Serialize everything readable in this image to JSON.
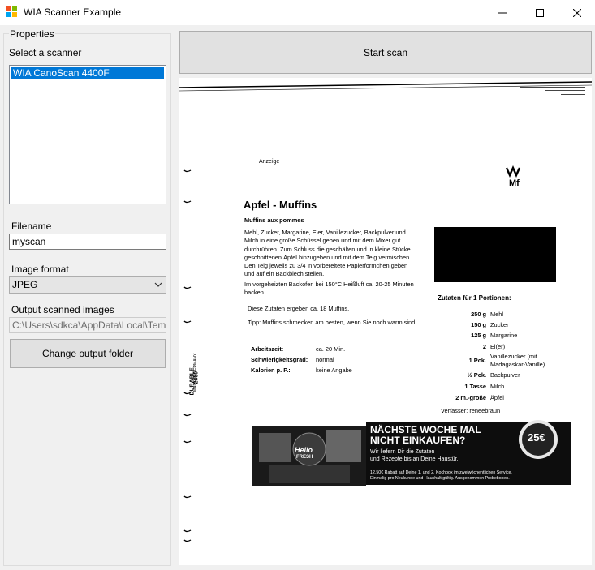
{
  "window": {
    "title": "WIA Scanner Example",
    "controls": {
      "minimize": "minimize",
      "maximize": "maximize",
      "close": "close"
    }
  },
  "left_panel": {
    "group_title": "Properties",
    "scanner_label": "Select a scanner",
    "scanners": [
      "WIA CanoScan 4400F"
    ],
    "selected_scanner": "WIA CanoScan 4400F",
    "filename_label": "Filename",
    "filename_value": "myscan",
    "format_label": "Image format",
    "format_selected": "JPEG",
    "output_label": "Output scanned images",
    "output_path": "C:\\Users\\sdkca\\AppData\\Local\\Temp\\",
    "change_folder_button": "Change output folder"
  },
  "toolbar": {
    "start_scan_button": "Start scan"
  },
  "scan_preview": {
    "ad_label": "Anzeige",
    "brand": "WMF",
    "recipe_title": "Apfel - Muffins",
    "recipe_subtitle": "Muffins aux pommes",
    "paragraph1": "Mehl, Zucker, Margarine, Eier, Vanillezucker, Backpulver und Milch in eine große Schüssel geben und mit dem Mixer gut durchrühren. Zum Schluss die geschälten und in kleine Stücke geschnittenen Äpfel hinzugeben und mit dem Teig vermischen. Den Teig jeweils zu 3/4 in vorbereitete Papierförmchen geben und auf ein Backblech stellen.",
    "paragraph2": "Im vorgeheizten Backofen bei 150°C Heißluft ca. 20-25 Minuten backen.",
    "paragraph3": "Diese Zutaten ergeben ca. 18 Muffins.",
    "paragraph4": "Tipp: Muffins schmecken am besten, wenn Sie noch warm sind.",
    "details": [
      {
        "key": "Arbeitszeit:",
        "value": "ca. 20 Min."
      },
      {
        "key": "Schwierigkeitsgrad:",
        "value": "normal"
      },
      {
        "key": "Kalorien p. P.:",
        "value": "keine Angabe"
      }
    ],
    "ingredients_title": "Zutaten für 1 Portionen:",
    "ingredients": [
      {
        "qty": "250 g",
        "name": "Mehl"
      },
      {
        "qty": "150 g",
        "name": "Zucker"
      },
      {
        "qty": "125 g",
        "name": "Margarine"
      },
      {
        "qty": "2",
        "name": "Ei(er)"
      },
      {
        "qty": "1 Pck.",
        "name": "Vanillezucker (mit Madagaskar-Vanille)"
      },
      {
        "qty": "½ Pck.",
        "name": "Backpulver"
      },
      {
        "qty": "1 Tasse",
        "name": "Milch"
      },
      {
        "qty": "2 m.-große",
        "name": "Äpfel"
      }
    ],
    "author": "Verfasser: reneebraun",
    "binder_brand": "DURABLE",
    "binder_model": "2660",
    "binder_origin": "MADE IN GERMANY",
    "ad_headline_1": "NÄCHSTE WOCHE MAL",
    "ad_headline_2": "NICHT EINKAUFEN?",
    "ad_sub_1": "Wir liefern Dir die Zutaten",
    "ad_sub_2": "und Rezepte bis an Deine Haustür.",
    "ad_fine_1": "12,50€ Rabatt auf Deine 1. und 2. Kochbox im zweiwöchentlichen Service.",
    "ad_fine_2": "Einmalig pro Neukunde und Haushalt gültig. Ausgenommen Probeboxen.",
    "ad_logo_1": "Hello",
    "ad_logo_2": "FRESH",
    "ad_badge": "25€"
  }
}
